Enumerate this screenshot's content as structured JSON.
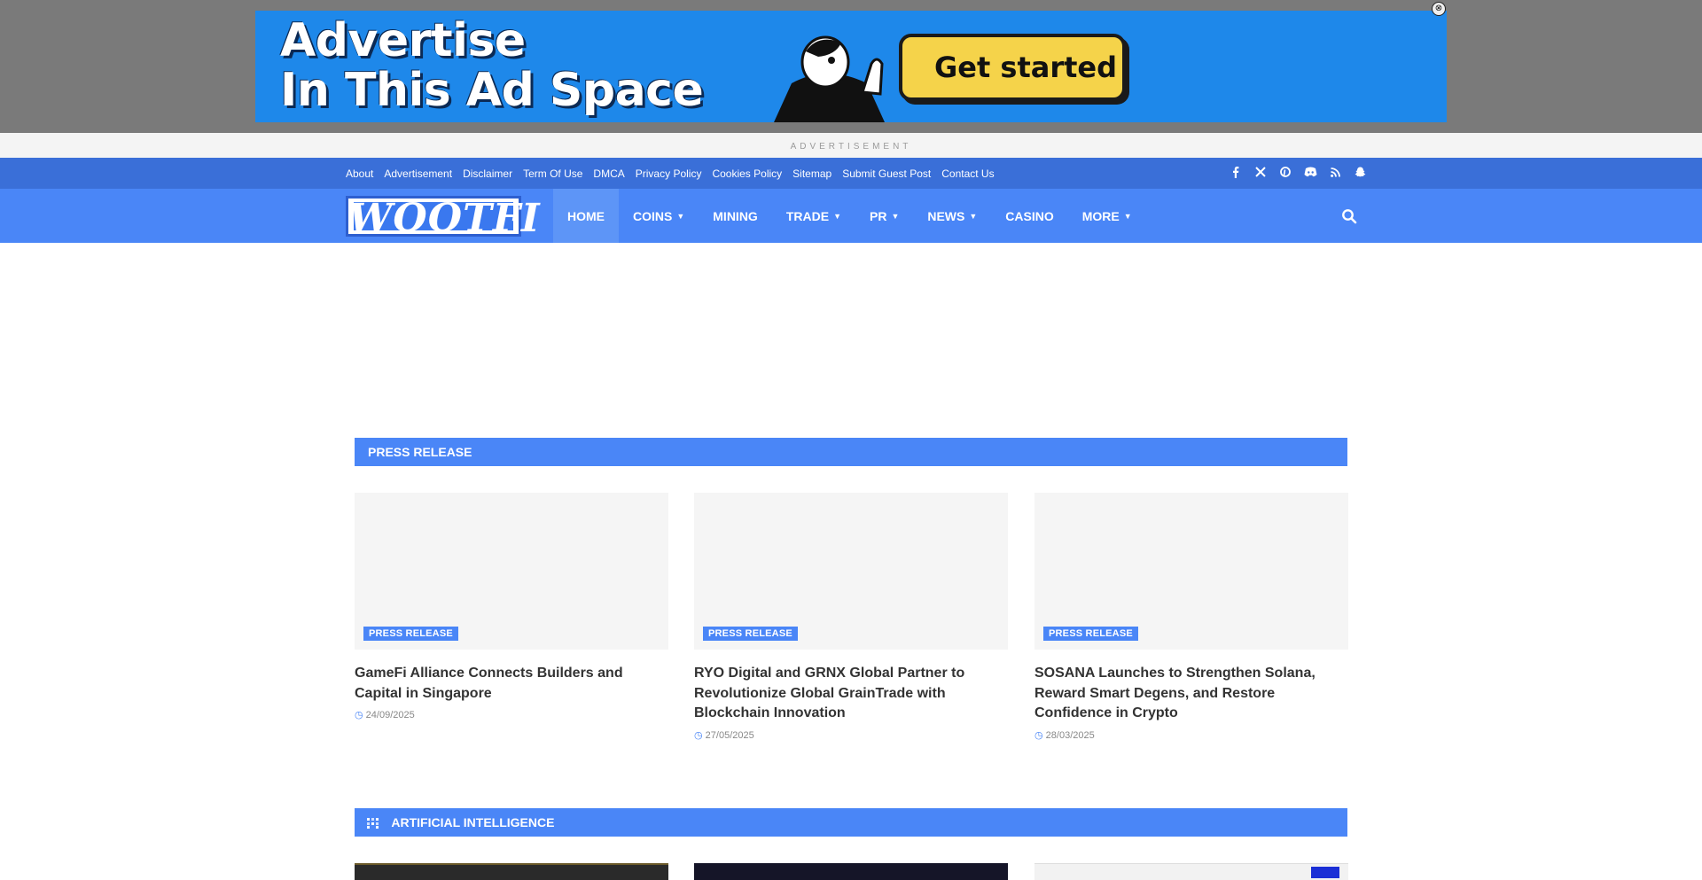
{
  "ad": {
    "headline_line1": "Advertise",
    "headline_line2": "In This Ad Space",
    "cta": "Get started",
    "label": "ADVERTISEMENT"
  },
  "topbar": {
    "links": [
      "About",
      "Advertisement",
      "Disclaimer",
      "Term Of Use",
      "DMCA",
      "Privacy Policy",
      "Cookies Policy",
      "Sitemap",
      "Submit Guest Post",
      "Contact Us"
    ],
    "social_icons": [
      "facebook-icon",
      "x-icon",
      "pinterest-icon",
      "discord-icon",
      "rss-icon",
      "snapchat-icon"
    ]
  },
  "nav": {
    "logo": "WOOTFI",
    "items": [
      {
        "label": "HOME",
        "dropdown": false
      },
      {
        "label": "COINS",
        "dropdown": true
      },
      {
        "label": "MINING",
        "dropdown": false
      },
      {
        "label": "TRADE",
        "dropdown": true
      },
      {
        "label": "PR",
        "dropdown": true
      },
      {
        "label": "NEWS",
        "dropdown": true
      },
      {
        "label": "CASINO",
        "dropdown": false
      },
      {
        "label": "MORE",
        "dropdown": true
      }
    ],
    "active": "HOME"
  },
  "press": {
    "section_title": "PRESS RELEASE",
    "cards": [
      {
        "badge": "PRESS RELEASE",
        "title": "GameFi Alliance Connects Builders and Capital in Singapore",
        "date": "24/09/2025"
      },
      {
        "badge": "PRESS RELEASE",
        "title": "RYO Digital and GRNX Global Partner to Revolutionize Global GrainTrade with Blockchain Innovation",
        "date": "27/05/2025"
      },
      {
        "badge": "PRESS RELEASE",
        "title": "SOSANA Launches to Strengthen Solana, Reward Smart Degens, and Restore Confidence in Crypto",
        "date": "28/03/2025"
      }
    ]
  },
  "ai": {
    "section_title": "ARTIFICIAL INTELLIGENCE"
  },
  "colors": {
    "primary": "#4a86f7",
    "topbar": "#3a6fd8",
    "ad_blue": "#1e88ea",
    "cta_yellow": "#f5d34a"
  }
}
